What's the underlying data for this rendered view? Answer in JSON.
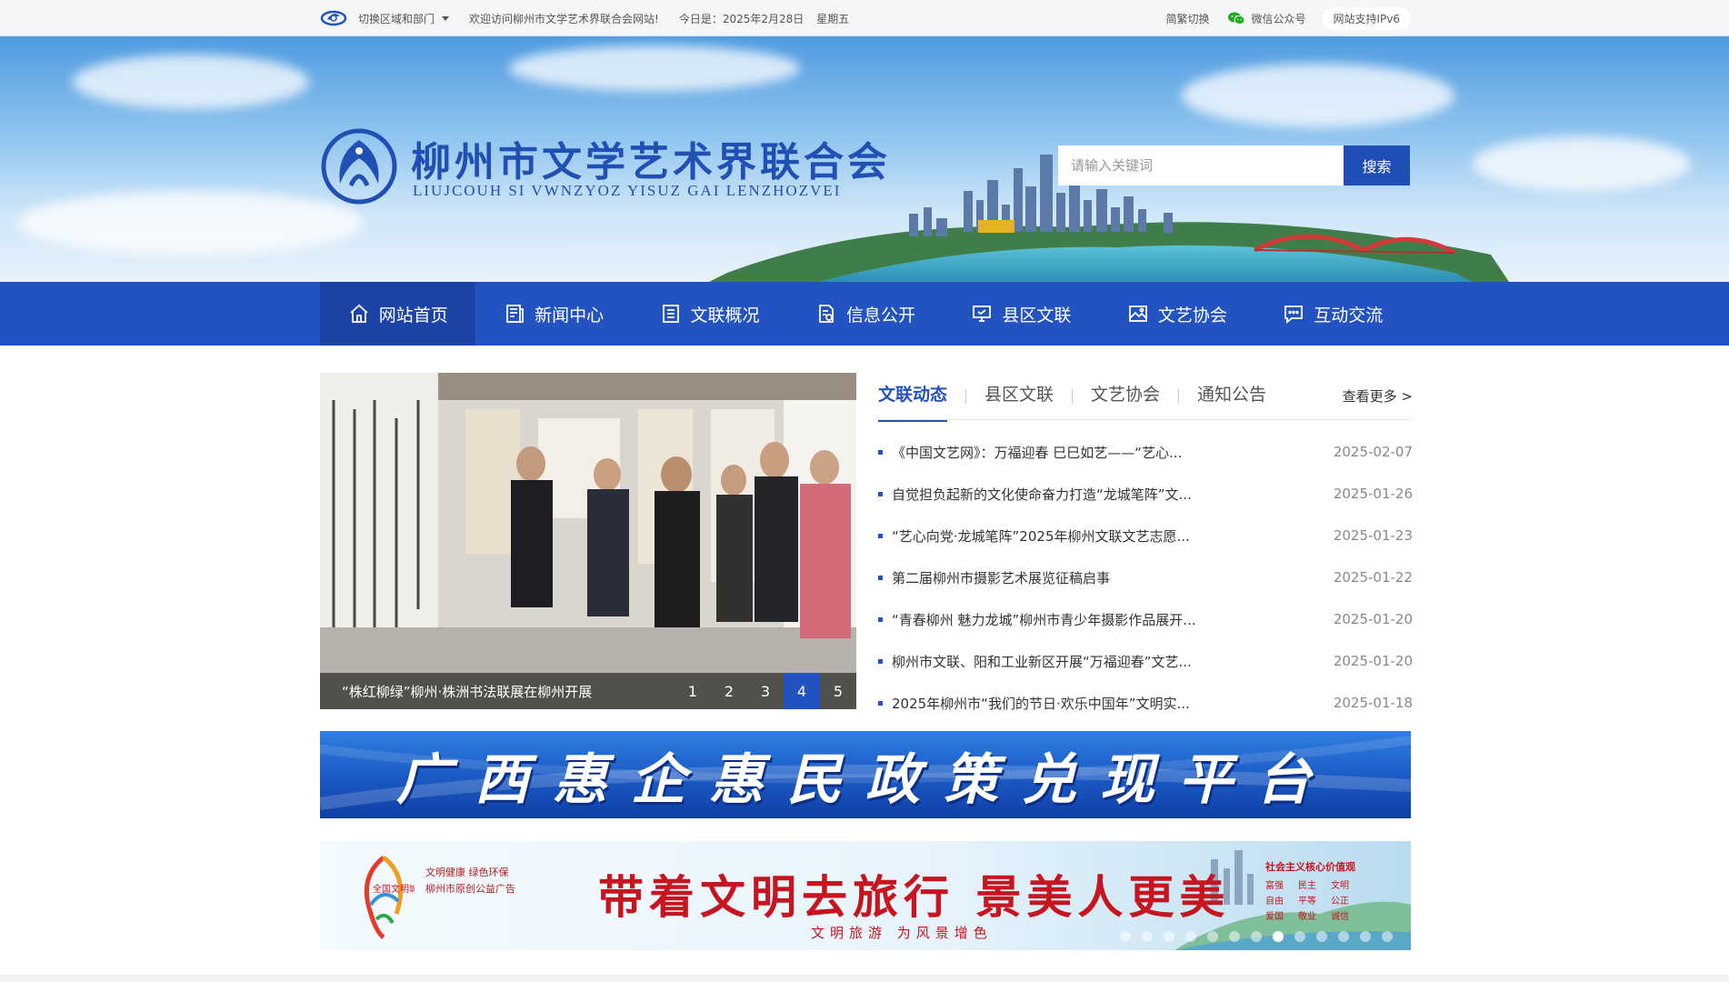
{
  "topbar": {
    "region_switch": "切换区域和部门",
    "welcome": "欢迎访问柳州市文学艺术界联合会网站!",
    "date": "今日是：2025年2月28日",
    "weekday": "星期五",
    "simp_trad": "简繁切换",
    "wechat": "微信公众号",
    "ipv6": "网站支持IPv6"
  },
  "header": {
    "title": "柳州市文学艺术界联合会",
    "subtitle": "LIUJCOUH SI VWNZYOZ YISUZ GAI LENZHOZVEI"
  },
  "search": {
    "placeholder": "请输入关键词",
    "button": "搜索"
  },
  "nav": {
    "items": [
      {
        "label": "网站首页",
        "icon": "home-icon"
      },
      {
        "label": "新闻中心",
        "icon": "news-icon"
      },
      {
        "label": "文联概况",
        "icon": "list-icon"
      },
      {
        "label": "信息公开",
        "icon": "document-icon"
      },
      {
        "label": "县区文联",
        "icon": "monitor-icon"
      },
      {
        "label": "文艺协会",
        "icon": "picture-icon"
      },
      {
        "label": "互动交流",
        "icon": "chat-icon"
      }
    ]
  },
  "slider": {
    "caption": "“株红柳绿”柳州·株洲书法联展在柳州开展",
    "pages": [
      "1",
      "2",
      "3",
      "4",
      "5"
    ],
    "active_page": "4"
  },
  "news": {
    "tabs": [
      "文联动态",
      "县区文联",
      "文艺协会",
      "通知公告"
    ],
    "more": "查看更多 >",
    "items": [
      {
        "title": "《中国文艺网》：万福迎春 巳巳如艺——“艺心...",
        "date": "2025-02-07"
      },
      {
        "title": "自觉担负起新的文化使命奋力打造“龙城笔阵”文...",
        "date": "2025-01-26"
      },
      {
        "title": "“艺心向党·龙城笔阵”2025年柳州文联文艺志愿...",
        "date": "2025-01-23"
      },
      {
        "title": "第二届柳州市摄影艺术展览征稿启事",
        "date": "2025-01-22"
      },
      {
        "title": "“青春柳州 魅力龙城”柳州市青少年摄影作品展开...",
        "date": "2025-01-20"
      },
      {
        "title": "柳州市文联、阳和工业新区开展“万福迎春”文艺...",
        "date": "2025-01-20"
      },
      {
        "title": "2025年柳州市“我们的节日·欢乐中国年”文明实...",
        "date": "2025-01-18"
      }
    ]
  },
  "ads": {
    "policy_banner": "广西惠企惠民政策兑现平台",
    "civil_small_1": "文明健康 绿色环保",
    "civil_small_2": "柳州市原创公益广告",
    "civil_logo_text": "全国文明城市",
    "civil_headline": "带着文明去旅行 景美人更美",
    "civil_sub": "文明旅游 为风景增色",
    "civil_values_title": "社会主义核心价值观",
    "civil_values": [
      "富强",
      "民主",
      "文明",
      "自由",
      "平等",
      "公正",
      "爱国",
      "敬业",
      "诚信"
    ]
  },
  "colors": {
    "primary": "#2353c0",
    "nav_active": "#1b44a6",
    "ad_red": "#c8141e"
  }
}
